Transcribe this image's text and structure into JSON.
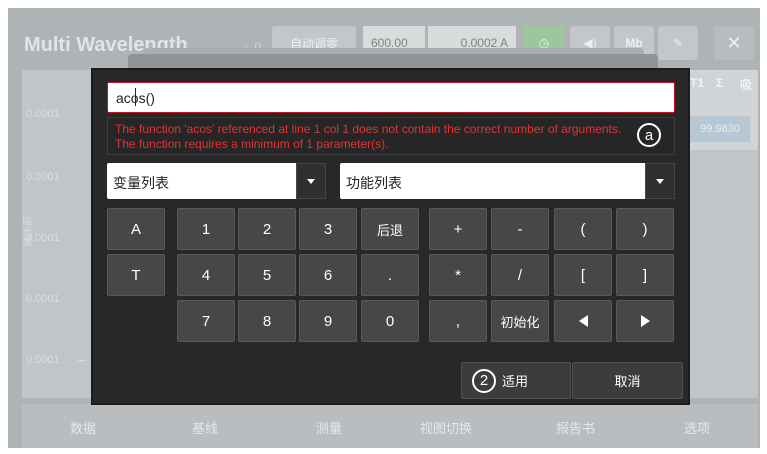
{
  "background": {
    "app_title": "Multi Wavelength",
    "toolbar": {
      "autozero_label": "自动调零",
      "wavelength_value": "600.00",
      "absorbance_value": "0.0002 A",
      "unit_label": "Mb"
    },
    "table_headers": [
      "T1",
      "Σ",
      "吸"
    ],
    "table_value": "99.9830",
    "y_axis_title": "吸光度",
    "y_ticks": [
      "0.0001",
      "0.0001",
      "0.0001",
      "0.0001",
      "0.0001"
    ],
    "bottom_nav": [
      "数据",
      "基线",
      "测量",
      "视图切换",
      "报告书",
      "选项"
    ]
  },
  "dialog": {
    "expression": "acos()",
    "error_message": "The function 'acos' referenced at line 1 col 1 does not contain the correct number of arguments. The function requires a minimum of 1 parameter(s).",
    "annotation_a": "ⓐ",
    "annotation_2": "2",
    "variable_list_label": "变量列表",
    "function_list_label": "功能列表",
    "keypad": {
      "row1": [
        "A",
        "1",
        "2",
        "3",
        "后退",
        "+",
        "-",
        "(",
        ")"
      ],
      "row2": [
        "T",
        "4",
        "5",
        "6",
        ".",
        "*",
        "/",
        "[",
        "]"
      ],
      "row3": [
        "7",
        "8",
        "9",
        "0",
        ",",
        "初始化"
      ]
    },
    "apply_label": "适用",
    "cancel_label": "取消"
  },
  "colors": {
    "dialog_bg": "#282828",
    "key_bg": "#474747",
    "error_text": "#e23333",
    "input_border": "#c4131e"
  }
}
